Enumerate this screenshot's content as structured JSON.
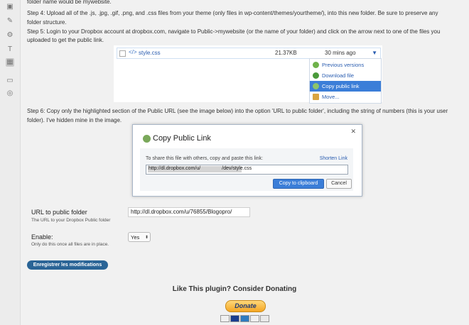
{
  "sidebar": {
    "icons": [
      "media-icon",
      "brush-icon",
      "wrench-icon",
      "text-icon",
      "calendar-icon",
      "plugin-icon",
      "settings-icon"
    ]
  },
  "content": {
    "line0": "folder name would be mywebsite.",
    "step4_a": "Step 4: Upload all of the .js, .jpg, .gif, .png, and .css files from your theme (only files in wp-content/themes/yourtheme/), into this new folder. Be sure to preserve any",
    "step4_b": "folder structure.",
    "step5_a": "Step 5: Login to your Dropbox account at dropbox.com, navigate to Public->mywebsite (or the name of your folder) and click on the arrow next to one of the files you",
    "step5_b": "uploaded to get the public link.",
    "step6_a": "Step 6: Copy only the highlighted section of the Public URL (see the image below) into the option 'URL to public folder', including the string of numbers (this is your user",
    "step6_b": "folder). I've hidden mine in the image."
  },
  "file_shot": {
    "file_name": "style.css",
    "file_size": "21.37KB",
    "file_date": "30 mins ago",
    "menu": [
      "Previous versions",
      "Download file",
      "Copy public link",
      "Move..."
    ]
  },
  "dialog_shot": {
    "title": "Copy Public Link",
    "share_text": "To share this file with others, copy and paste this link:",
    "shorten": "Shorten Link",
    "url_part1": "http://dl.dropbox.com/u/",
    "url_part2": "/dev/style.css",
    "copy_button": "Copy to clipboard",
    "cancel_button": "Cancel"
  },
  "form": {
    "url_label": "URL to public folder",
    "url_desc": "The URL to your Dropbox Public folder",
    "url_value": "http://dl.dropbox.com/u/76855/Blogopro/",
    "enable_label": "Enable:",
    "enable_desc": "Only do this once all files are in place.",
    "enable_value": "Yes",
    "save_button": "Enregistrer les modifications"
  },
  "donate": {
    "title": "Like This plugin? Consider Donating",
    "button": "Donate"
  }
}
